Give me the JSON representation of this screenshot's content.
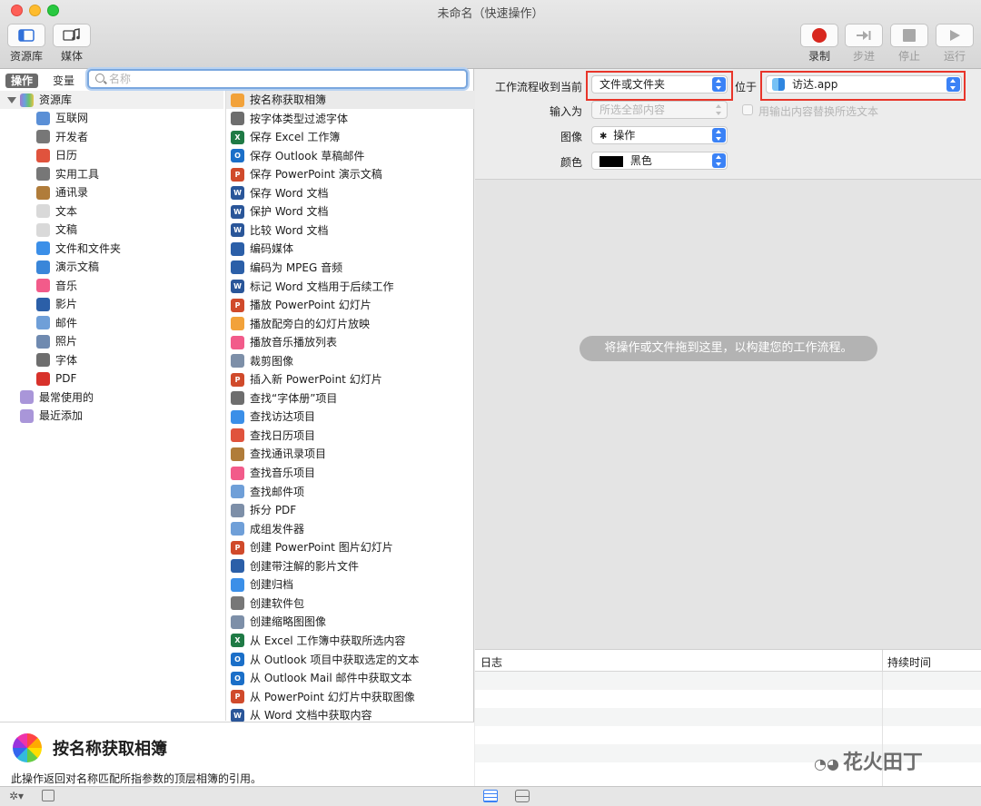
{
  "window": {
    "title": "未命名（快速操作）"
  },
  "toolbar": {
    "library_label": "资源库",
    "media_label": "媒体",
    "record_label": "录制",
    "step_label": "步进",
    "stop_label": "停止",
    "run_label": "运行"
  },
  "left": {
    "tab_actions": "操作",
    "tab_variables": "变量",
    "search_placeholder": "名称",
    "library_root": "资源库",
    "library_items": [
      {
        "label": "互联网",
        "icon": "globe-icon",
        "color": "#5a8fd6"
      },
      {
        "label": "开发者",
        "icon": "tools-icon",
        "color": "#777777"
      },
      {
        "label": "日历",
        "icon": "calendar-icon",
        "color": "#e0533d"
      },
      {
        "label": "实用工具",
        "icon": "tools-icon",
        "color": "#777777"
      },
      {
        "label": "通讯录",
        "icon": "contacts-icon",
        "color": "#b07c3a"
      },
      {
        "label": "文本",
        "icon": "text-icon",
        "color": "#d9d9d9"
      },
      {
        "label": "文稿",
        "icon": "document-icon",
        "color": "#d9d9d9"
      },
      {
        "label": "文件和文件夹",
        "icon": "finder-icon",
        "color": "#3b8fe8"
      },
      {
        "label": "演示文稿",
        "icon": "keynote-icon",
        "color": "#3a86d9"
      },
      {
        "label": "音乐",
        "icon": "music-icon",
        "color": "#f25b8a"
      },
      {
        "label": "影片",
        "icon": "quicktime-icon",
        "color": "#2b5fa8"
      },
      {
        "label": "邮件",
        "icon": "mail-icon",
        "color": "#6f9fd8"
      },
      {
        "label": "照片",
        "icon": "photos-icon",
        "color": "#6f8ab0"
      },
      {
        "label": "字体",
        "icon": "font-icon",
        "color": "#6e6e6e"
      },
      {
        "label": "PDF",
        "icon": "pdf-icon",
        "color": "#d8322b"
      }
    ],
    "smart_items": [
      {
        "label": "最常使用的",
        "icon": "smart-folder-icon"
      },
      {
        "label": "最近添加",
        "icon": "smart-folder-icon"
      }
    ],
    "actions": [
      {
        "label": "按名称获取相簿",
        "icon": "photos-icon",
        "color": "#f2a23a"
      },
      {
        "label": "按字体类型过滤字体",
        "icon": "font-icon",
        "color": "#6e6e6e"
      },
      {
        "label": "保存 Excel 工作簿",
        "icon": "excel-icon",
        "color": "#1f7a45",
        "letter": "X"
      },
      {
        "label": "保存 Outlook 草稿邮件",
        "icon": "outlook-icon",
        "color": "#1b6fc8",
        "letter": "O"
      },
      {
        "label": "保存 PowerPoint 演示文稿",
        "icon": "powerpoint-icon",
        "color": "#d04a2b",
        "letter": "P"
      },
      {
        "label": "保存 Word 文档",
        "icon": "word-icon",
        "color": "#2a5699",
        "letter": "W"
      },
      {
        "label": "保护 Word 文档",
        "icon": "word-icon",
        "color": "#2a5699",
        "letter": "W"
      },
      {
        "label": "比较 Word 文档",
        "icon": "word-icon",
        "color": "#2a5699",
        "letter": "W"
      },
      {
        "label": "编码媒体",
        "icon": "quicktime-icon",
        "color": "#2b5fa8"
      },
      {
        "label": "编码为 MPEG 音频",
        "icon": "quicktime-icon",
        "color": "#2b5fa8"
      },
      {
        "label": "标记 Word 文档用于后续工作",
        "icon": "word-icon",
        "color": "#2a5699",
        "letter": "W"
      },
      {
        "label": "播放 PowerPoint 幻灯片",
        "icon": "powerpoint-icon",
        "color": "#d04a2b",
        "letter": "P"
      },
      {
        "label": "播放配旁白的幻灯片放映",
        "icon": "photos-icon",
        "color": "#f2a23a"
      },
      {
        "label": "播放音乐播放列表",
        "icon": "music-icon",
        "color": "#f25b8a"
      },
      {
        "label": "裁剪图像",
        "icon": "preview-icon",
        "color": "#7d8fa8"
      },
      {
        "label": "插入新 PowerPoint 幻灯片",
        "icon": "powerpoint-icon",
        "color": "#d04a2b",
        "letter": "P"
      },
      {
        "label": "查找“字体册”项目",
        "icon": "font-icon",
        "color": "#6e6e6e"
      },
      {
        "label": "查找访达项目",
        "icon": "finder-icon",
        "color": "#3b8fe8"
      },
      {
        "label": "查找日历项目",
        "icon": "calendar-icon",
        "color": "#e0533d"
      },
      {
        "label": "查找通讯录项目",
        "icon": "contacts-icon",
        "color": "#b07c3a"
      },
      {
        "label": "查找音乐项目",
        "icon": "music-icon",
        "color": "#f25b8a"
      },
      {
        "label": "查找邮件项",
        "icon": "mail-icon",
        "color": "#6f9fd8"
      },
      {
        "label": "拆分 PDF",
        "icon": "preview-icon",
        "color": "#7d8fa8"
      },
      {
        "label": "成组发件器",
        "icon": "mail-icon",
        "color": "#6f9fd8"
      },
      {
        "label": "创建 PowerPoint 图片幻灯片",
        "icon": "powerpoint-icon",
        "color": "#d04a2b",
        "letter": "P"
      },
      {
        "label": "创建带注解的影片文件",
        "icon": "quicktime-icon",
        "color": "#2b5fa8"
      },
      {
        "label": "创建归档",
        "icon": "finder-icon",
        "color": "#3b8fe8"
      },
      {
        "label": "创建软件包",
        "icon": "tools-icon",
        "color": "#777777"
      },
      {
        "label": "创建缩略图图像",
        "icon": "preview-icon",
        "color": "#7d8fa8"
      },
      {
        "label": "从 Excel 工作簿中获取所选内容",
        "icon": "excel-icon",
        "color": "#1f7a45",
        "letter": "X"
      },
      {
        "label": "从 Outlook 项目中获取选定的文本",
        "icon": "outlook-icon",
        "color": "#1b6fc8",
        "letter": "O"
      },
      {
        "label": "从 Outlook Mail 邮件中获取文本",
        "icon": "outlook-icon",
        "color": "#1b6fc8",
        "letter": "O"
      },
      {
        "label": "从 PowerPoint 幻灯片中获取图像",
        "icon": "powerpoint-icon",
        "color": "#d04a2b",
        "letter": "P"
      },
      {
        "label": "从 Word 文档中获取内容",
        "icon": "word-icon",
        "color": "#2a5699",
        "letter": "W"
      }
    ],
    "description_title": "按名称获取相簿",
    "description_text": "此操作返回对名称匹配所指参数的顶层相簿的引用。"
  },
  "workflow": {
    "receives_label": "工作流程收到当前",
    "receives_value": "文件或文件夹",
    "in_label": "位于",
    "in_value": "访达.app",
    "input_label": "输入为",
    "input_value": "所选全部内容",
    "replace_label": "用输出内容替换所选文本",
    "image_label": "图像",
    "image_value": "操作",
    "color_label": "颜色",
    "color_value": "黑色",
    "drop_hint": "将操作或文件拖到这里，以构建您的工作流程。"
  },
  "log": {
    "col_log": "日志",
    "col_duration": "持续时间"
  },
  "watermark": "花火田丁",
  "colors": {
    "record": "#d8271e",
    "accent": "#3b82f6",
    "highlight_box": "#e8352a"
  }
}
